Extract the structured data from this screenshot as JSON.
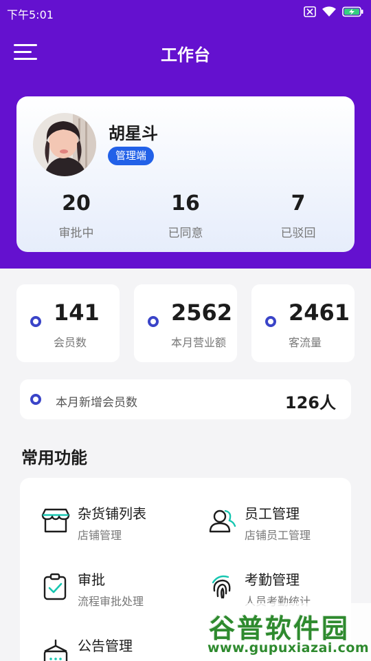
{
  "status_bar": {
    "time": "下午5:01"
  },
  "header": {
    "title": "工作台"
  },
  "profile": {
    "name": "胡星斗",
    "role": "管理端",
    "stats": [
      {
        "value": "20",
        "label": "审批中"
      },
      {
        "value": "16",
        "label": "已同意"
      },
      {
        "value": "7",
        "label": "已驳回"
      }
    ]
  },
  "summary": [
    {
      "value": "141",
      "label": "会员数"
    },
    {
      "value": "2562",
      "label": "本月营业额"
    },
    {
      "value": "2461",
      "label": "客流量"
    }
  ],
  "new_members": {
    "label": "本月新增会员数",
    "value": "126人"
  },
  "functions": {
    "title": "常用功能",
    "items": [
      {
        "title": "杂货铺列表",
        "subtitle": "店铺管理",
        "icon": "store-icon"
      },
      {
        "title": "员工管理",
        "subtitle": "店铺员工管理",
        "icon": "staff-icon"
      },
      {
        "title": "审批",
        "subtitle": "流程审批处理",
        "icon": "approval-icon"
      },
      {
        "title": "考勤管理",
        "subtitle": "人员考勤统计",
        "icon": "fingerprint-icon"
      },
      {
        "title": "公告管理",
        "subtitle": "",
        "icon": "announcement-icon"
      }
    ]
  },
  "watermark": {
    "title": "谷普软件园",
    "url": "www.gupuxiazai.com"
  },
  "colors": {
    "header_bg": "#6411cf",
    "badge": "#2261e8",
    "dot": "#3a44c8",
    "icon_teal": "#16c6b0"
  }
}
